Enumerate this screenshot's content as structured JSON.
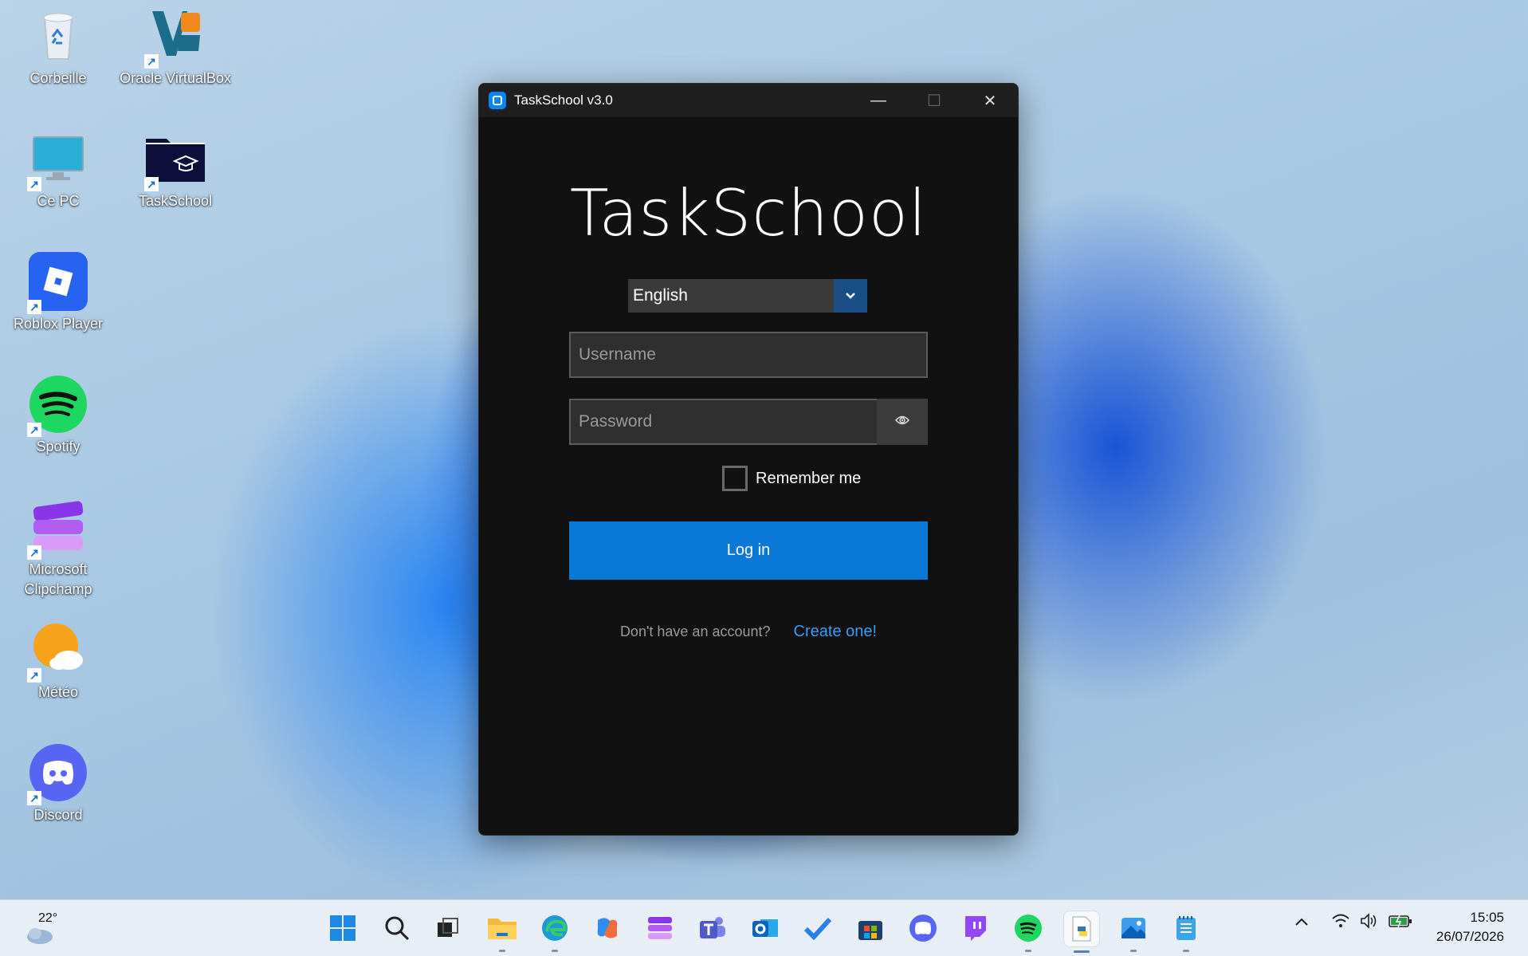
{
  "desktop": {
    "icons": [
      {
        "label": "Corbeille"
      },
      {
        "label": "Oracle VirtualBox"
      },
      {
        "label": "Ce PC"
      },
      {
        "label": "TaskSchool"
      },
      {
        "label": "Roblox Player"
      },
      {
        "label": "Spotify"
      },
      {
        "label": "Microsoft Clipchamp"
      },
      {
        "label": "Météo"
      },
      {
        "label": "Discord"
      }
    ]
  },
  "window": {
    "title": "TaskSchool v3.0",
    "minimize_icon": "—",
    "maximize_icon": "☐",
    "close_icon": "✕"
  },
  "login": {
    "brand": "TaskSchool",
    "language": "English",
    "username_placeholder": "Username",
    "password_placeholder": "Password",
    "remember_label": "Remember me",
    "login_label": "Log in",
    "signup_question": "Don't have an account?",
    "signup_link": "Create one!"
  },
  "taskbar": {
    "weather_temp": "22°",
    "time": "15:05",
    "date": "26/07/2026"
  },
  "colors": {
    "accent": "#0a78d7",
    "link": "#3a9bf5",
    "window_bg": "#111111"
  }
}
